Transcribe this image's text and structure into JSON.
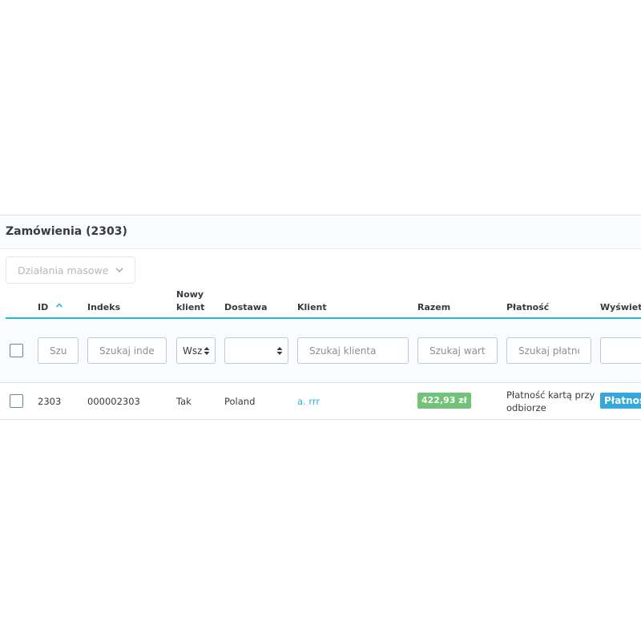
{
  "panel": {
    "title": "Zamówienia (2303)"
  },
  "bulk": {
    "label": "Działania masowe",
    "icon": "chevron-down-icon"
  },
  "columns": {
    "id": "ID",
    "index": "Indeks",
    "new_client_line1": "Nowy",
    "new_client_line2": "klient",
    "delivery": "Dostawa",
    "client": "Klient",
    "total": "Razem",
    "payment": "Płatność",
    "display": "Wyświetla"
  },
  "filters": {
    "id_placeholder": "Szukaj ID",
    "index_placeholder": "Szukaj indeks",
    "new_client_value": "Wszystkie",
    "delivery_value": "",
    "client_placeholder": "Szukaj klienta",
    "total_placeholder": "Szukaj wartość",
    "payment_placeholder": "Szukaj płatność",
    "display_placeholder": ""
  },
  "orders": [
    {
      "id": "2303",
      "index": "000002303",
      "new_client": "Tak",
      "delivery": "Poland",
      "client": "a. rrr",
      "total": "422,93 zł",
      "payment_line1": "Płatność kartą przy",
      "payment_line2": "odbiorze",
      "status": "Płatność"
    }
  ],
  "colors": {
    "accent": "#25b9d7",
    "badge_total": "#72c279",
    "badge_status": "#34a7db"
  }
}
